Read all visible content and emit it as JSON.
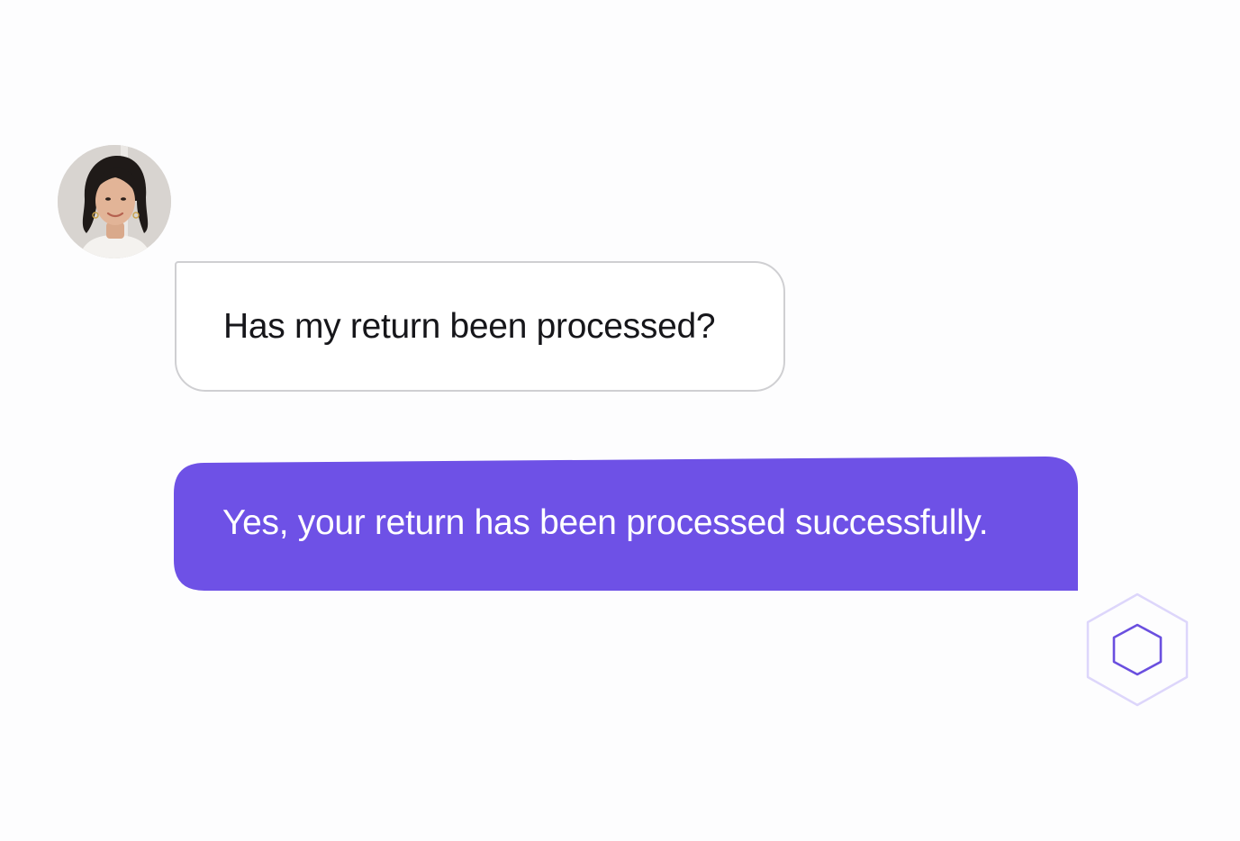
{
  "conversation": {
    "user": {
      "avatar_alt": "user-avatar",
      "message": "Has my return been processed?"
    },
    "assistant": {
      "message": "Yes, your return has been processed successfully.",
      "icon": "hexagon-icon"
    }
  },
  "colors": {
    "assistant_bubble": "#6e51e6",
    "user_bubble_border": "#cfcfd2",
    "hexagon_outer": "#ddd6fb",
    "hexagon_inner": "#6a4fdf"
  }
}
